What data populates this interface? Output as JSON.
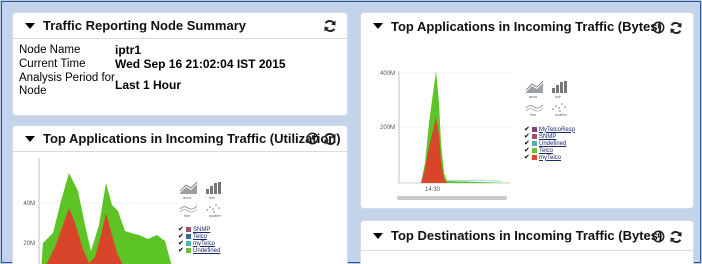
{
  "summary": {
    "title": "Traffic Reporting Node Summary",
    "rows": [
      {
        "label": "Node Name",
        "value": "iptr1"
      },
      {
        "label": "Current Time",
        "value": "Wed Sep 16 21:02:04 IST 2015"
      },
      {
        "label": "Analysis Period for Node",
        "value": "Last 1 Hour"
      }
    ]
  },
  "top_apps_util": {
    "title": "Top Applications in Incoming Traffic (Utilization)",
    "y_ticks": [
      "40M",
      "20M"
    ],
    "chart_types": [
      "area",
      "bar",
      "line",
      "scatter"
    ],
    "legend": [
      {
        "name": "SNMP",
        "color": "#a0506e"
      },
      {
        "name": "Telco",
        "color": "#3a69a6"
      },
      {
        "name": "myTelco",
        "color": "#4fb3b0"
      },
      {
        "name": "Undefined",
        "color": "#6fbf3a"
      }
    ]
  },
  "top_apps_bytes": {
    "title": "Top Applications in Incoming Traffic (Bytes)",
    "y_ticks": [
      "400M",
      "200M"
    ],
    "x_tick": "14:30",
    "chart_types": [
      "area",
      "bar",
      "line",
      "scatter"
    ],
    "legend": [
      {
        "name": "MyTelcoResp",
        "color": "#8a3a7a"
      },
      {
        "name": "SNMP",
        "color": "#a0506e"
      },
      {
        "name": "Undefined",
        "color": "#4fb3b0"
      },
      {
        "name": "Telco",
        "color": "#6fbf3a"
      },
      {
        "name": "myTelco",
        "color": "#d94a2c"
      }
    ]
  },
  "top_dest_bytes": {
    "title": "Top Destinations in Incoming Traffic (Bytes)"
  },
  "colors": {
    "green_series": "#5cc424",
    "red_series": "#d8452a",
    "background": "#c3d4ea"
  }
}
